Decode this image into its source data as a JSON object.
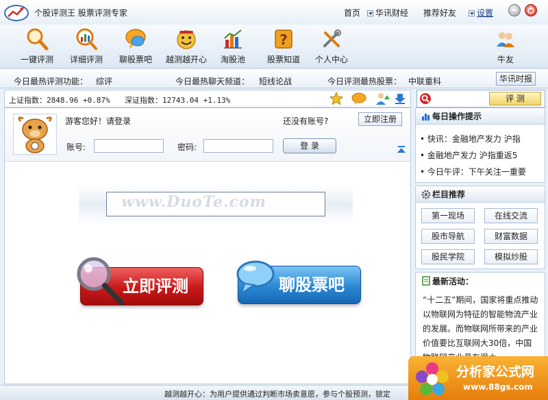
{
  "app": {
    "title": "个股评测王  股票评测专家",
    "nav": {
      "home": "首页",
      "news": "华讯财经",
      "recommend": "推荐好友",
      "settings": "设置"
    }
  },
  "toolbar": {
    "items": [
      {
        "label": "一键评测",
        "icon": "magnifier-icon"
      },
      {
        "label": "详细评测",
        "icon": "chart-magnifier-icon"
      },
      {
        "label": "聊股票吧",
        "icon": "chat-bubble-icon"
      },
      {
        "label": "越测越开心",
        "icon": "smiley-icon"
      },
      {
        "label": "淘股池",
        "icon": "bar-chart-icon"
      },
      {
        "label": "股票知道",
        "icon": "question-box-icon"
      },
      {
        "label": "个人中心",
        "icon": "tools-icon"
      }
    ],
    "friends": {
      "label": "牛友",
      "icon": "users-icon"
    }
  },
  "hotbar": {
    "eval_label": "今日最热评测功能：",
    "eval_value": "综评",
    "chat_label": "今日最热聊天频道：",
    "chat_value": "短线论战",
    "stock_label": "今日评测最热股票：",
    "stock_value": "中联重科",
    "news_button": "华讯时报"
  },
  "index": {
    "sh_label": "上证指数：",
    "sh_value": "2848.96 +0.87%",
    "sz_label": "深证指数：",
    "sz_value": "12743.04 +1.13%"
  },
  "login": {
    "greeting": "游客您好！请登录",
    "no_account": "还没有账号?",
    "register_button": "立即注册",
    "account_label": "账号:",
    "password_label": "密码:",
    "login_button": "登 录"
  },
  "watermark": "www.DuoTe.com",
  "main_buttons": {
    "evaluate": "立即评测",
    "chat": "聊股票吧"
  },
  "sidebar": {
    "search_button": "评 测",
    "daily_tips_title": "每日操作提示",
    "tips": [
      "快讯：金融地产发力 沪指",
      "金融地产发力 沪指重返5",
      "今日午评：下午关注一重要"
    ],
    "columns_title": "栏目推荐",
    "columns": [
      "第一现场",
      "在线交流",
      "股市导航",
      "财富数据",
      "股民学院",
      "模拟炒股"
    ],
    "activity_title": "最新活动：",
    "activity_text": "“十二五”期间，国家将重点推动以物联网为特征的智能物流产业的发展。而物联网所带来的产业价值要比互联网大30倍，中国物联网产业具有很大"
  },
  "status": {
    "text": "越测越开心：为用户提供通过判断市场卖意愿，参与个股预测，锁定"
  },
  "badge": {
    "title": "分析家公式网",
    "url": "www.88gs.com"
  }
}
